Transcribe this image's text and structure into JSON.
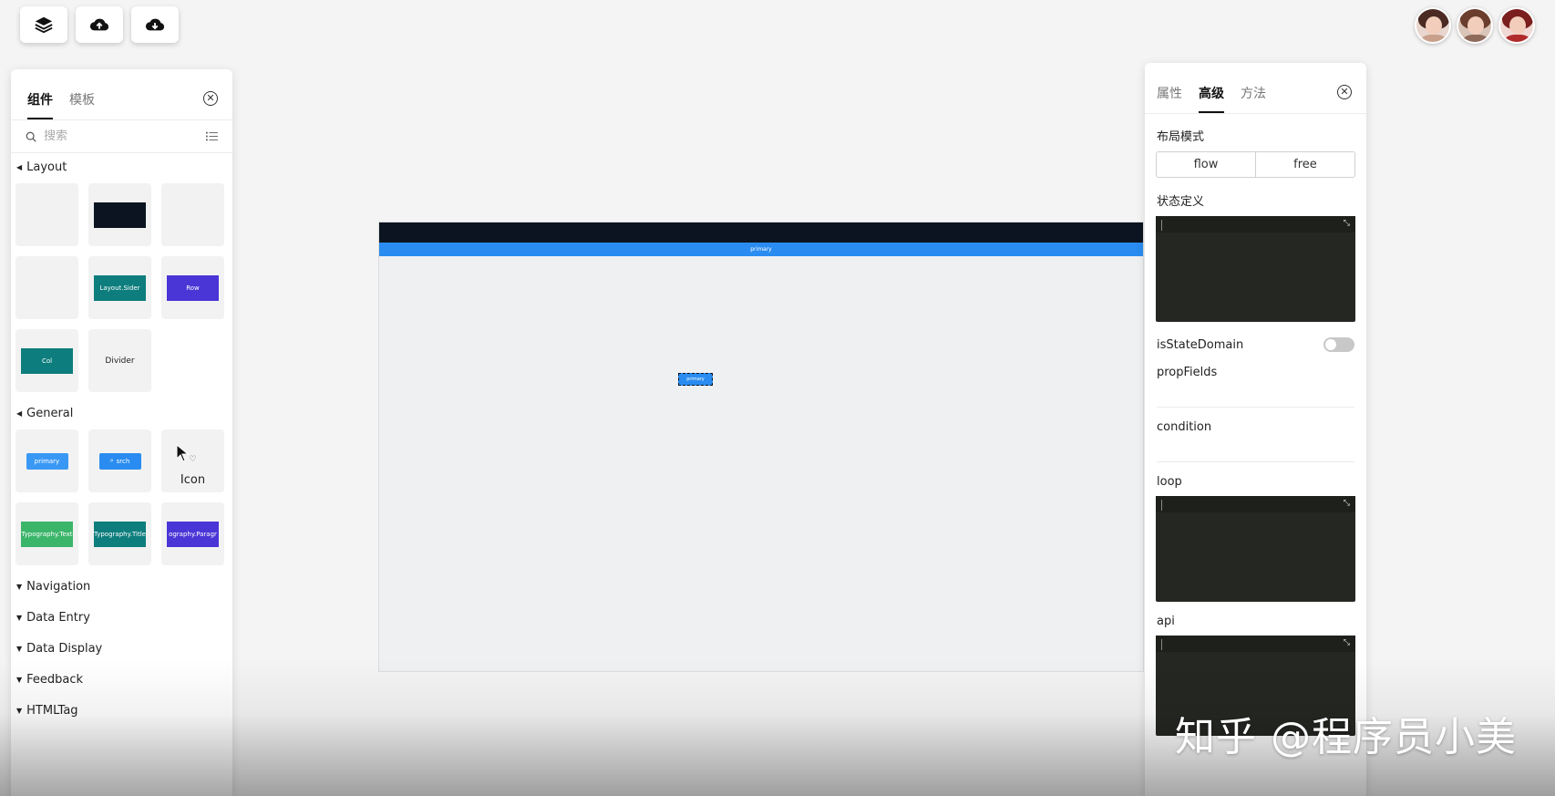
{
  "left_panel": {
    "tabs": [
      "组件",
      "模板"
    ],
    "search_placeholder": "搜索",
    "sections": {
      "layout": "Layout",
      "general": "General",
      "navigation": "Navigation",
      "data_entry": "Data Entry",
      "data_display": "Data Display",
      "feedback": "Feedback",
      "htmltag": "HTMLTag"
    },
    "layout_items": [
      "Layout.Sider",
      "Row",
      "Col",
      "Divider"
    ],
    "general_items": [
      "primary",
      "srch",
      "Icon",
      "Typography.Text",
      "Typography.Title",
      "ography.Paragr"
    ]
  },
  "canvas": {
    "bar_label": "primary",
    "button_label": "primary"
  },
  "right_panel": {
    "tabs": [
      "属性",
      "高级",
      "方法"
    ],
    "layout_mode_label": "布局模式",
    "layout_options": [
      "flow",
      "free"
    ],
    "state_def_label": "状态定义",
    "is_state_domain_label": "isStateDomain",
    "prop_fields_label": "propFields",
    "condition_label": "condition",
    "loop_label": "loop",
    "api_label": "api"
  },
  "watermark": "知乎 @程序员小美",
  "colors": {
    "primary": "#2a8cf0",
    "dark": "#0b1420",
    "teal": "#0e7d7d",
    "purple": "#4a35d6",
    "green": "#3bb56a",
    "code_bg": "#252723"
  },
  "icons": {
    "tools": [
      "layers-icon",
      "cloud-upload-icon",
      "cloud-download-icon"
    ]
  }
}
